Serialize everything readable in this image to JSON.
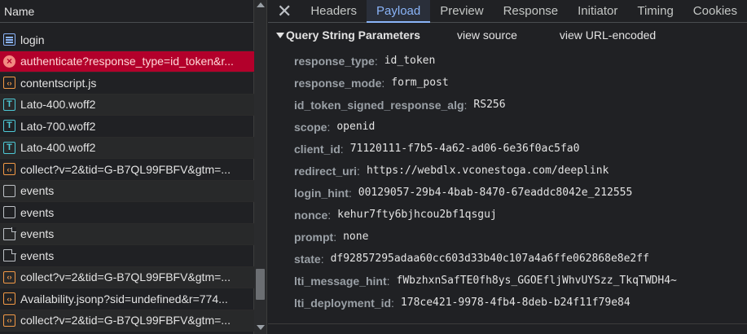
{
  "list": {
    "header": "Name",
    "rows": [
      {
        "label": "login",
        "icon": "document-icon",
        "type": "doc",
        "error": false
      },
      {
        "label": "authenticate?response_type=id_token&r...",
        "icon": "error-icon",
        "type": "error",
        "error": true
      },
      {
        "label": "contentscript.js",
        "icon": "script-icon",
        "type": "code",
        "error": false
      },
      {
        "label": "Lato-400.woff2",
        "icon": "font-icon",
        "type": "font",
        "error": false
      },
      {
        "label": "Lato-700.woff2",
        "icon": "font-icon",
        "type": "font",
        "error": false
      },
      {
        "label": "Lato-400.woff2",
        "icon": "font-icon",
        "type": "font",
        "error": false
      },
      {
        "label": "collect?v=2&tid=G-B7QL99FBFV&gtm=...",
        "icon": "script-icon",
        "type": "code",
        "error": false
      },
      {
        "label": "events",
        "icon": "checkbox-icon",
        "type": "box",
        "error": false
      },
      {
        "label": "events",
        "icon": "checkbox-icon",
        "type": "box",
        "error": false
      },
      {
        "label": "events",
        "icon": "page-icon",
        "type": "page",
        "error": false
      },
      {
        "label": "events",
        "icon": "page-icon",
        "type": "page",
        "error": false
      },
      {
        "label": "collect?v=2&tid=G-B7QL99FBFV&gtm=...",
        "icon": "script-icon",
        "type": "code",
        "error": false
      },
      {
        "label": "Availability.jsonp?sid=undefined&r=774...",
        "icon": "script-icon",
        "type": "code",
        "error": false
      },
      {
        "label": "collect?v=2&tid=G-B7QL99FBFV&gtm=...",
        "icon": "script-icon",
        "type": "code",
        "error": false
      }
    ]
  },
  "tabs": {
    "close": "✕",
    "items": [
      {
        "label": "Headers",
        "active": false
      },
      {
        "label": "Payload",
        "active": true
      },
      {
        "label": "Preview",
        "active": false
      },
      {
        "label": "Response",
        "active": false
      },
      {
        "label": "Initiator",
        "active": false
      },
      {
        "label": "Timing",
        "active": false
      },
      {
        "label": "Cookies",
        "active": false
      }
    ]
  },
  "payload": {
    "section_title": "Query String Parameters",
    "view_source": "view source",
    "view_url_encoded": "view URL-encoded",
    "params": [
      {
        "key": "response_type",
        "value": "id_token"
      },
      {
        "key": "response_mode",
        "value": "form_post"
      },
      {
        "key": "id_token_signed_response_alg",
        "value": "RS256"
      },
      {
        "key": "scope",
        "value": "openid"
      },
      {
        "key": "client_id",
        "value": "71120111-f7b5-4a62-ad06-6e36f0ac5fa0"
      },
      {
        "key": "redirect_uri",
        "value": "https://webdlx.vconestoga.com/deeplink"
      },
      {
        "key": "login_hint",
        "value": "00129057-29b4-4bab-8470-67eaddc8042e_212555"
      },
      {
        "key": "nonce",
        "value": "kehur7fty6bjhcou2bf1qsguj"
      },
      {
        "key": "prompt",
        "value": "none"
      },
      {
        "key": "state",
        "value": "df92857295adaa60cc603d33b40c107a4a6ffe062868e8e2ff"
      },
      {
        "key": "lti_message_hint",
        "value": "fWbzhxnSafTE0fh8ys_GGOEfljWhvUYSzz_TkqTWDH4~"
      },
      {
        "key": "lti_deployment_id",
        "value": "178ce421-9978-4fb4-8deb-b24f11f79e84"
      }
    ]
  }
}
